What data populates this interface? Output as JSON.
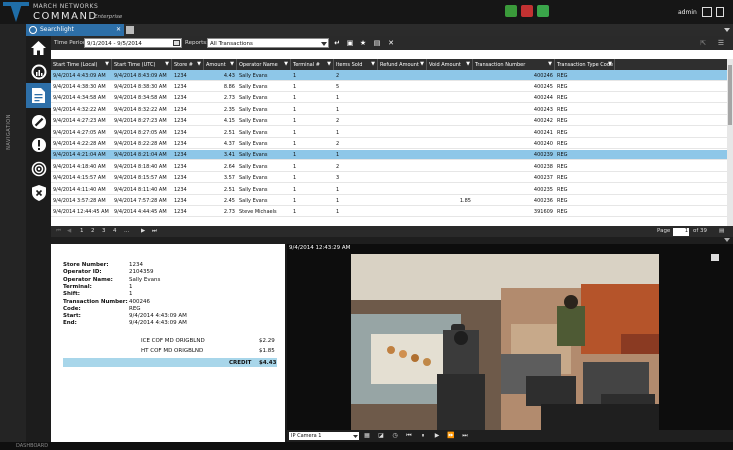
{
  "app": {
    "brand_line1": "MARCH NETWORKS",
    "brand_line2": "COMMAND",
    "brand_line3": "Enterprise",
    "user": "admin",
    "accent": "#2d6fa8"
  },
  "tabs": [
    {
      "label": "Searchlight"
    }
  ],
  "nav": {
    "label": "NAVIGATION"
  },
  "filter": {
    "time_period_label": "Time Period",
    "time_period_value": "9/1/2014 - 9/5/2014",
    "reports_label": "Reports:",
    "reports_value": "All Transactions"
  },
  "grid": {
    "columns": [
      "Start Time (Local)",
      "Start Time (UTC)",
      "Store #",
      "Amount",
      "Operator Name",
      "Terminal #",
      "Items Sold",
      "Refund Amount",
      "Void Amount",
      "Transaction Number",
      "Transaction Type Code"
    ],
    "rows": [
      [
        "9/4/2014 4:43:09 AM",
        "9/4/2014 8:43:09 AM",
        "1234",
        "4.43",
        "Sally Evans",
        "1",
        "2",
        "",
        "",
        "400246",
        "REG"
      ],
      [
        "9/4/2014 4:38:30 AM",
        "9/4/2014 8:38:30 AM",
        "1234",
        "8.86",
        "Sally Evans",
        "1",
        "5",
        "",
        "",
        "400245",
        "REG"
      ],
      [
        "9/4/2014 4:34:58 AM",
        "9/4/2014 8:34:58 AM",
        "1234",
        "2.73",
        "Sally Evans",
        "1",
        "1",
        "",
        "",
        "400244",
        "REG"
      ],
      [
        "9/4/2014 4:32:22 AM",
        "9/4/2014 8:32:22 AM",
        "1234",
        "2.35",
        "Sally Evans",
        "1",
        "1",
        "",
        "",
        "400243",
        "REG"
      ],
      [
        "9/4/2014 4:27:23 AM",
        "9/4/2014 8:27:23 AM",
        "1234",
        "4.15",
        "Sally Evans",
        "1",
        "2",
        "",
        "",
        "400242",
        "REG"
      ],
      [
        "9/4/2014 4:27:05 AM",
        "9/4/2014 8:27:05 AM",
        "1234",
        "2.51",
        "Sally Evans",
        "1",
        "1",
        "",
        "",
        "400241",
        "REG"
      ],
      [
        "9/4/2014 4:22:28 AM",
        "9/4/2014 8:22:28 AM",
        "1234",
        "4.37",
        "Sally Evans",
        "1",
        "2",
        "",
        "",
        "400240",
        "REG"
      ],
      [
        "9/4/2014 4:21:04 AM",
        "9/4/2014 8:21:04 AM",
        "1234",
        "3.41",
        "Sally Evans",
        "1",
        "1",
        "",
        "",
        "400239",
        "REG"
      ],
      [
        "9/4/2014 4:18:40 AM",
        "9/4/2014 8:18:40 AM",
        "1234",
        "2.64",
        "Sally Evans",
        "1",
        "2",
        "",
        "",
        "400238",
        "REG"
      ],
      [
        "9/4/2014 4:15:57 AM",
        "9/4/2014 8:15:57 AM",
        "1234",
        "3.57",
        "Sally Evans",
        "1",
        "3",
        "",
        "",
        "400237",
        "REG"
      ],
      [
        "9/4/2014 4:11:40 AM",
        "9/4/2014 8:11:40 AM",
        "1234",
        "2.51",
        "Sally Evans",
        "1",
        "1",
        "",
        "",
        "400235",
        "REG"
      ],
      [
        "9/4/2014 3:57:28 AM",
        "9/4/2014 7:57:28 AM",
        "1234",
        "2.45",
        "Sally Evans",
        "1",
        "1",
        "",
        "1.85",
        "400236",
        "REG"
      ],
      [
        "9/4/2014 12:44:45 AM",
        "9/4/2014 4:44:45 AM",
        "1234",
        "2.73",
        "Steve Michaels",
        "1",
        "1",
        "",
        "",
        "391609",
        "REG"
      ]
    ],
    "selected_rows": [
      0,
      7
    ]
  },
  "pager": {
    "pages": [
      "1",
      "2",
      "3",
      "4",
      "..."
    ],
    "page_label": "Page",
    "page_value": "1",
    "of_label": "of 39"
  },
  "detail": {
    "fields": [
      {
        "k": "Store Number:",
        "v": "1234"
      },
      {
        "k": "Operator ID:",
        "v": "2104359"
      },
      {
        "k": "Operator Name:",
        "v": "Sally Evans"
      },
      {
        "k": "Terminal:",
        "v": "1"
      },
      {
        "k": "Shift:",
        "v": "1"
      },
      {
        "k": "Transaction Number:",
        "v": "400246"
      },
      {
        "k": "Code:",
        "v": "REG"
      },
      {
        "k": "Start:",
        "v": "9/4/2014 4:43:09 AM"
      },
      {
        "k": "End:",
        "v": "9/4/2014 4:43:09 AM"
      }
    ],
    "items": [
      {
        "name": "ICE COF MD ORIGBLND",
        "price": "$2.29"
      },
      {
        "name": "HT COF MD ORIGBLND",
        "price": "$1.85"
      }
    ],
    "credit_label": "CREDIT",
    "credit_value": "$4.43"
  },
  "video": {
    "timestamp": "9/4/2014 12:43:29 AM",
    "camera": "IP Camera 1"
  },
  "statusbar": {
    "label": "DASHBOARD"
  }
}
